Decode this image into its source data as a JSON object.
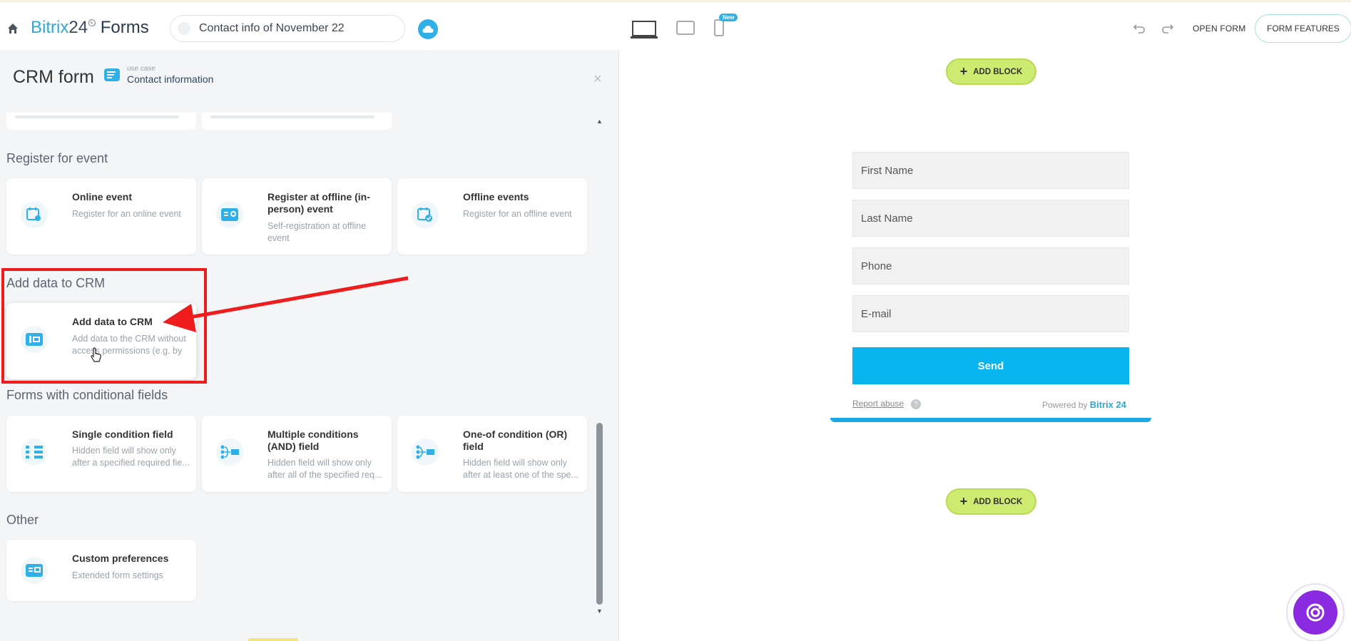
{
  "header": {
    "brand_part1": "Bitrix",
    "brand_part2": "24",
    "brand_clock": "⏲",
    "brand_part3": "Forms",
    "form_title": "Contact info of November 22",
    "new_badge": "New",
    "open_form_label": "OPEN FORM",
    "form_features_label": "FORM FEATURES"
  },
  "panel": {
    "title": "CRM form",
    "use_case_label": "use case",
    "use_case_value": "Contact information",
    "close_symbol": "×",
    "scroll_up": "▲",
    "scroll_down": "▼"
  },
  "sections": {
    "register": {
      "label": "Register for event",
      "cards": [
        {
          "title": "Online event",
          "desc": "Register for an online event",
          "icon": "calendar-search-icon"
        },
        {
          "title": "Register at offline (in-person) event",
          "desc": "Self-registration at offline event",
          "icon": "location-card-icon"
        },
        {
          "title": "Offline events",
          "desc": "Register for an offline event",
          "icon": "calendar-check-icon"
        }
      ]
    },
    "crm": {
      "label": "Add data to CRM",
      "cards": [
        {
          "title": "Add data to CRM",
          "desc": "Add data to the CRM without access permissions (e.g. by f...",
          "icon": "crm-data-icon"
        }
      ]
    },
    "conditional": {
      "label": "Forms with conditional fields",
      "cards": [
        {
          "title": "Single condition field",
          "desc": "Hidden field will show only after a specified required fie...",
          "icon": "condition-list-icon"
        },
        {
          "title": "Multiple conditions (AND) field",
          "desc": "Hidden field will show only after all of the specified req...",
          "icon": "condition-and-icon"
        },
        {
          "title": "One-of condition (OR) field",
          "desc": "Hidden field will show only after at least one of the spe...",
          "icon": "condition-or-icon"
        }
      ]
    },
    "other": {
      "label": "Other",
      "cards": [
        {
          "title": "Custom preferences",
          "desc": "Extended form settings",
          "icon": "settings-card-icon"
        }
      ]
    }
  },
  "preview": {
    "add_block_label": "ADD BLOCK",
    "add_block_plus": "+",
    "fields": [
      "First Name",
      "Last Name",
      "Phone",
      "E-mail"
    ],
    "send_label": "Send",
    "report_abuse": "Report abuse",
    "help_symbol": "?",
    "powered_by": "Powered by",
    "powered_brand": "Bitrix 24"
  },
  "colors": {
    "accent": "#2fb1e8",
    "send": "#09b5ef",
    "add_block": "#cdeb70",
    "highlight": "#ee1c1c",
    "assistant": "#8a2be2"
  }
}
